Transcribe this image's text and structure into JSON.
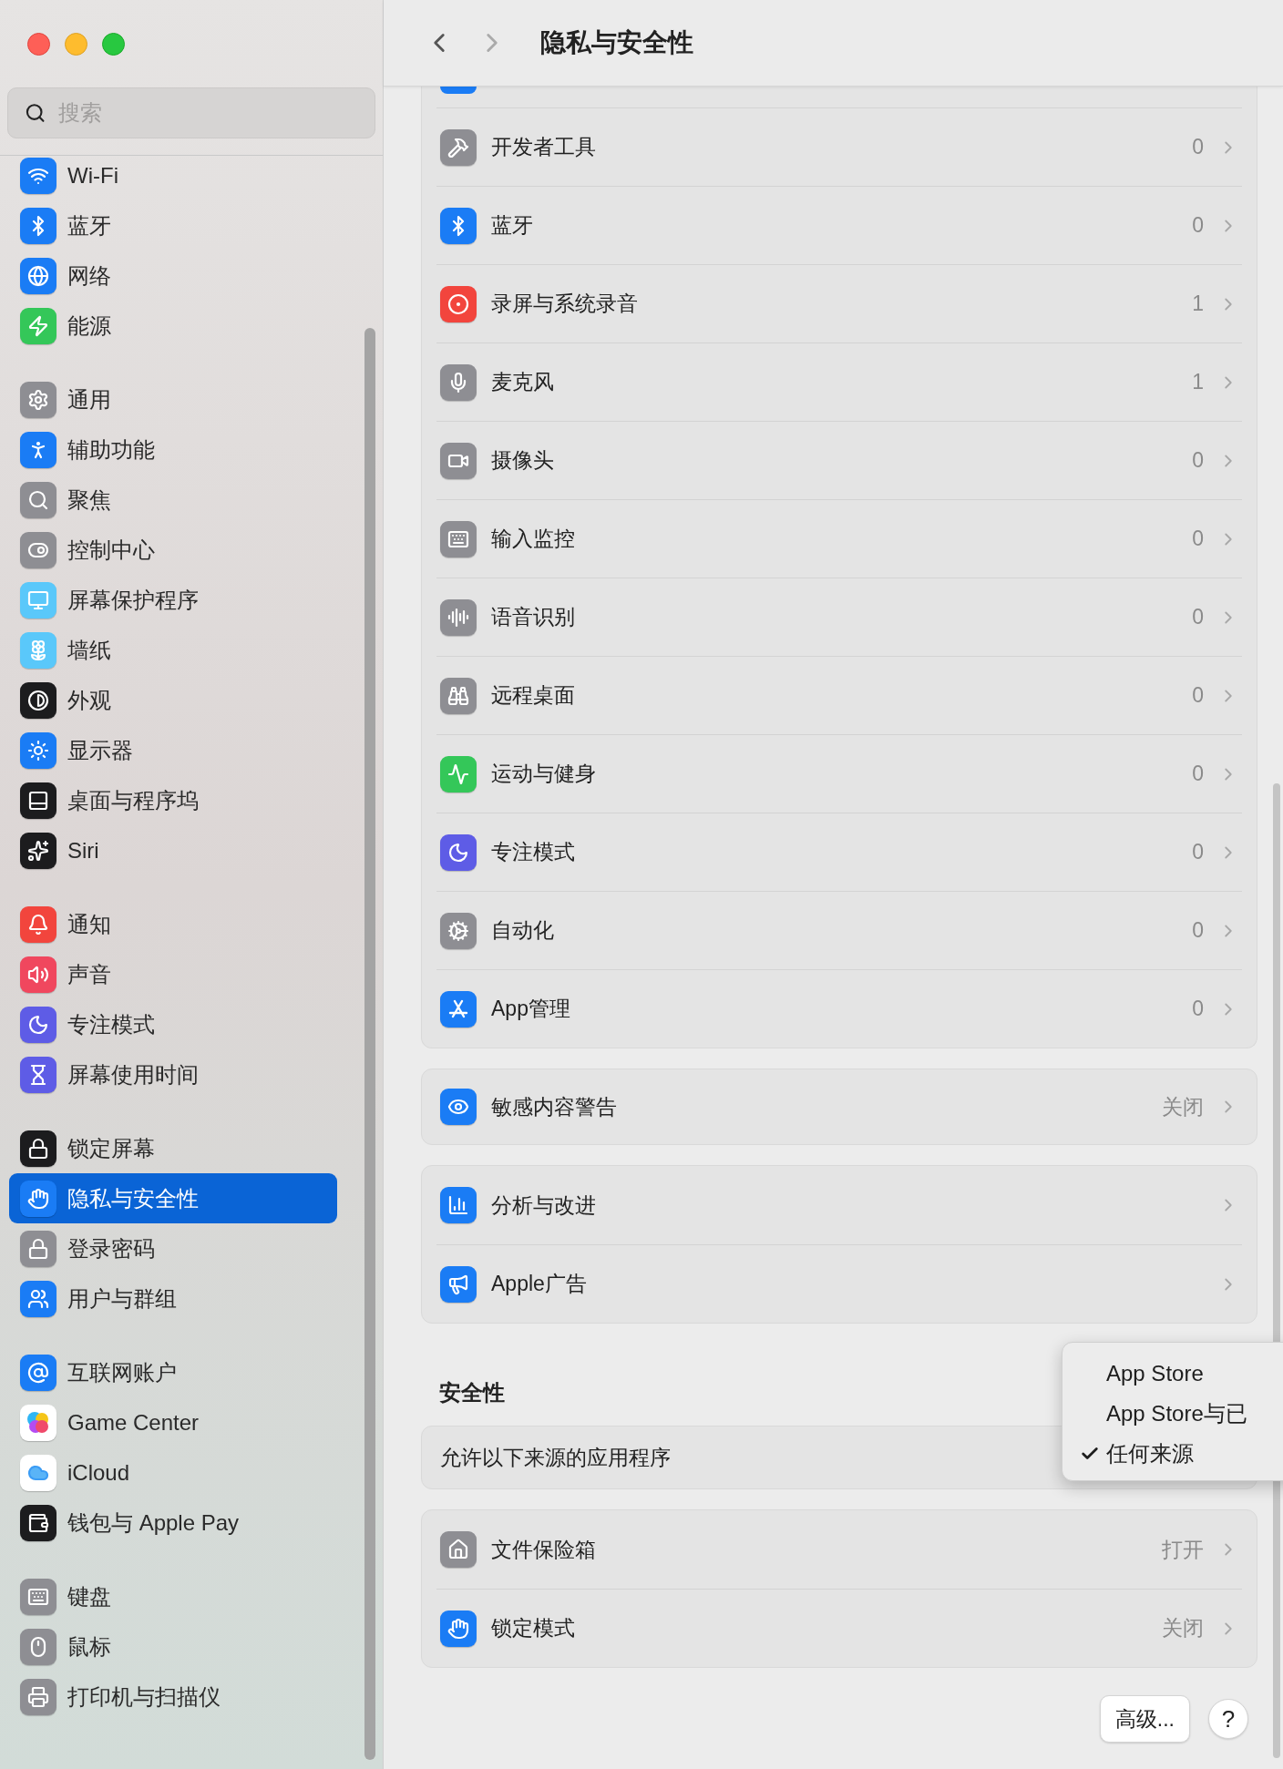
{
  "sidebar": {
    "search": {
      "placeholder": "搜索"
    },
    "groups": [
      {
        "items": [
          {
            "label": "Wi-Fi",
            "selected": false
          },
          {
            "label": "蓝牙",
            "selected": false
          },
          {
            "label": "网络",
            "selected": false
          },
          {
            "label": "能源",
            "selected": false
          }
        ]
      },
      {
        "items": [
          {
            "label": "通用",
            "selected": false
          },
          {
            "label": "辅助功能",
            "selected": false
          },
          {
            "label": "聚焦",
            "selected": false
          },
          {
            "label": "控制中心",
            "selected": false
          },
          {
            "label": "屏幕保护程序",
            "selected": false
          },
          {
            "label": "墙纸",
            "selected": false
          },
          {
            "label": "外观",
            "selected": false
          },
          {
            "label": "显示器",
            "selected": false
          },
          {
            "label": "桌面与程序坞",
            "selected": false
          },
          {
            "label": "Siri",
            "selected": false
          }
        ]
      },
      {
        "items": [
          {
            "label": "通知",
            "selected": false
          },
          {
            "label": "声音",
            "selected": false
          },
          {
            "label": "专注模式",
            "selected": false
          },
          {
            "label": "屏幕使用时间",
            "selected": false
          }
        ]
      },
      {
        "items": [
          {
            "label": "锁定屏幕",
            "selected": false
          },
          {
            "label": "隐私与安全性",
            "selected": true
          },
          {
            "label": "登录密码",
            "selected": false
          },
          {
            "label": "用户与群组",
            "selected": false
          }
        ]
      },
      {
        "items": [
          {
            "label": "互联网账户",
            "selected": false
          },
          {
            "label": "Game Center",
            "selected": false
          },
          {
            "label": "iCloud",
            "selected": false
          },
          {
            "label": "钱包与 Apple Pay",
            "selected": false
          }
        ]
      },
      {
        "items": [
          {
            "label": "键盘",
            "selected": false
          },
          {
            "label": "鼠标",
            "selected": false
          },
          {
            "label": "打印机与扫描仪",
            "selected": false
          }
        ]
      }
    ]
  },
  "toolbar": {
    "title": "隐私与安全性"
  },
  "privacy_list": [
    {
      "label": "开发者工具",
      "value": "0"
    },
    {
      "label": "蓝牙",
      "value": "0"
    },
    {
      "label": "录屏与系统录音",
      "value": "1"
    },
    {
      "label": "麦克风",
      "value": "1"
    },
    {
      "label": "摄像头",
      "value": "0"
    },
    {
      "label": "输入监控",
      "value": "0"
    },
    {
      "label": "语音识别",
      "value": "0"
    },
    {
      "label": "远程桌面",
      "value": "0"
    },
    {
      "label": "运动与健身",
      "value": "0"
    },
    {
      "label": "专注模式",
      "value": "0"
    },
    {
      "label": "自动化",
      "value": "0"
    },
    {
      "label": "App管理",
      "value": "0"
    }
  ],
  "sensitive_list": [
    {
      "label": "敏感内容警告",
      "value": "关闭"
    }
  ],
  "analytics_list": [
    {
      "label": "分析与改进"
    },
    {
      "label": "Apple广告"
    }
  ],
  "security": {
    "heading": "安全性",
    "allow_row": {
      "label": "允许以下来源的应用程序"
    },
    "popup": {
      "options": [
        {
          "label": "App Store",
          "selected": false
        },
        {
          "label": "App Store与已",
          "selected": false
        },
        {
          "label": "任何来源",
          "selected": true
        }
      ]
    },
    "items": [
      {
        "label": "文件保险箱",
        "value": "打开"
      },
      {
        "label": "锁定模式",
        "value": "关闭"
      }
    ]
  },
  "footer": {
    "advanced_button": "高级...",
    "help_button": "?"
  }
}
